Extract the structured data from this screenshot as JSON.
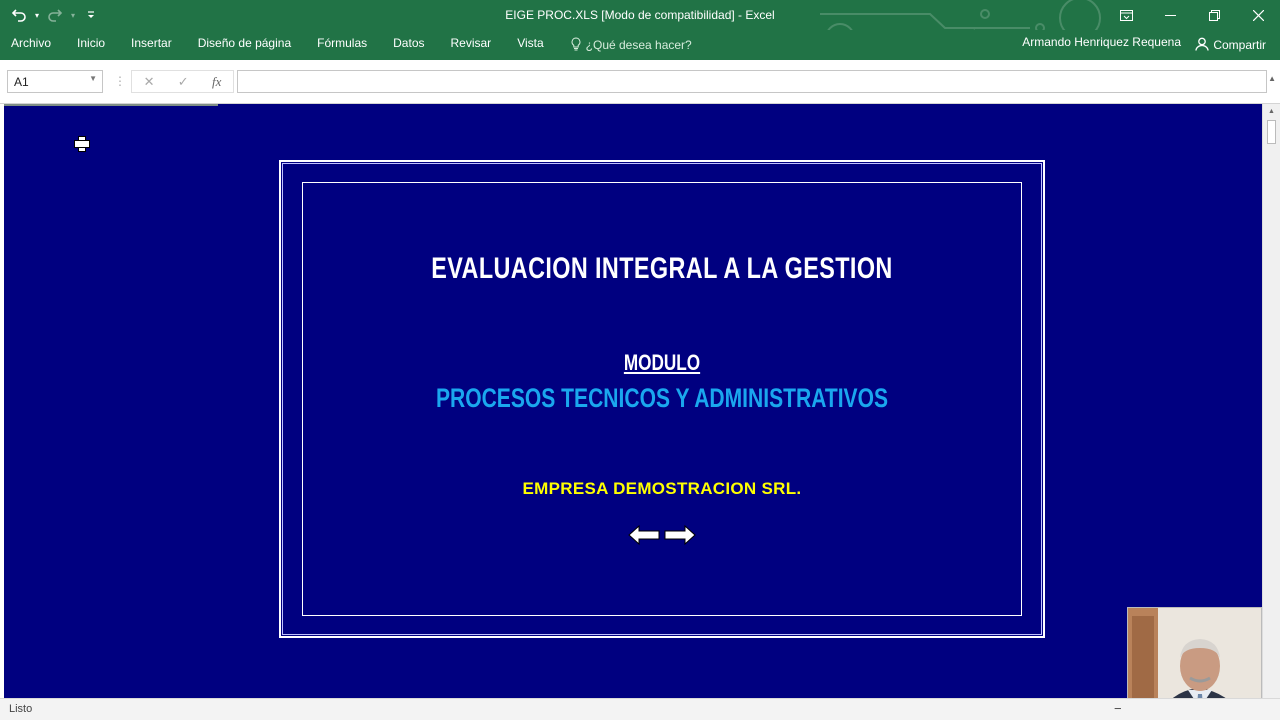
{
  "window": {
    "title": "EIGE PROC.XLS  [Modo de compatibilidad] - Excel",
    "controls": [
      "ribbon-display-icon",
      "minimize-icon",
      "restore-icon",
      "close-icon"
    ]
  },
  "quick_access": {
    "icons": [
      "undo-icon",
      "redo-icon",
      "customize-qat-icon"
    ]
  },
  "ribbon": {
    "tabs": [
      "Archivo",
      "Inicio",
      "Insertar",
      "Diseño de página",
      "Fórmulas",
      "Datos",
      "Revisar",
      "Vista"
    ],
    "tell_me": "¿Qué desea hacer?",
    "user": "Armando Henriquez Requena",
    "share": "Compartir"
  },
  "formula_bar": {
    "name_box": "A1",
    "formula": ""
  },
  "sheet": {
    "title": "EVALUACION INTEGRAL A LA GESTION",
    "modulo_label": "MODULO",
    "module_name": "PROCESOS TECNICOS Y ADMINISTRATIVOS",
    "company": "EMPRESA DEMOSTRACION SRL.",
    "nav_icons": [
      "arrow-left-icon",
      "arrow-right-icon"
    ]
  },
  "status_bar": {
    "status": "Listo"
  },
  "colors": {
    "brand": "#217346",
    "sheet_background": "#000080",
    "module_name_color": "#1aa7ee",
    "company_color": "#ffff00"
  }
}
